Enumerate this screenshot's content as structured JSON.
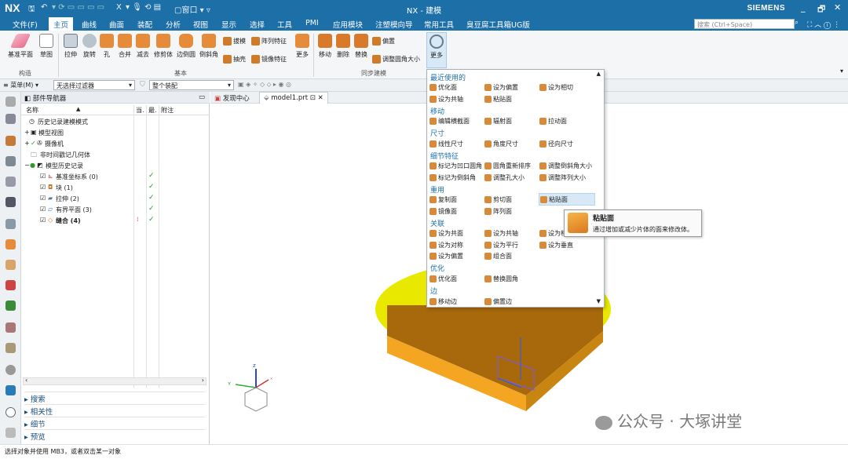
{
  "titlebar": {
    "logo": "NX",
    "title": "NX - 建模",
    "brand": "SIEMENS",
    "window_label": "窗口",
    "quick_close": "X"
  },
  "menu_tabs": [
    "文件(F)",
    "主页",
    "曲线",
    "曲面",
    "装配",
    "分析",
    "视图",
    "显示",
    "选择",
    "工具",
    "PMI",
    "应用模块",
    "注塑模向导",
    "常用工具",
    "臭豆腐工具箱UG版"
  ],
  "search": {
    "placeholder": "搜索 (Ctrl+Space)"
  },
  "ribbon": {
    "buttons": [
      "基准平面",
      "草图",
      "拉伸",
      "旋转",
      "孔",
      "合并",
      "减去",
      "修剪体",
      "边倒圆",
      "倒斜角",
      "更多",
      "移动",
      "删除",
      "替换",
      "更多"
    ],
    "small_buttons": [
      "拔模",
      "阵列特征",
      "抽壳",
      "镜像特征",
      "偏置",
      "调整圆角大小"
    ],
    "groups": [
      "构造",
      "基本",
      "同步建模"
    ]
  },
  "selbar": {
    "menu": "菜单(M)",
    "filter": "无选择过滤器",
    "scope": "整个装配"
  },
  "navigator": {
    "title": "部件导航器",
    "columns": [
      "名称",
      "当.",
      "最.",
      "附注"
    ],
    "rows": [
      {
        "label": "历史记录建模模式",
        "check": ""
      },
      {
        "label": "模型视图",
        "check": ""
      },
      {
        "label": "摄像机",
        "check": ""
      },
      {
        "label": "非时间戳记几何体",
        "check": ""
      },
      {
        "label": "模型历史记录",
        "check": ""
      },
      {
        "label": "基准坐标系 (0)",
        "check": "✓"
      },
      {
        "label": "块 (1)",
        "check": "✓"
      },
      {
        "label": "拉伸 (2)",
        "check": "✓"
      },
      {
        "label": "有界平面 (3)",
        "check": "✓"
      },
      {
        "label": "缝合 (4)",
        "check": "✓"
      }
    ],
    "accordion": [
      "搜索",
      "相关性",
      "细节",
      "预览"
    ]
  },
  "doc_tabs": [
    "发现中心",
    "model1.prt"
  ],
  "more_menu": {
    "sections": [
      {
        "title": "最近使用的",
        "items": [
          "优化面",
          "设为偏置",
          "设为相切",
          "设为共轴",
          "粘贴面"
        ]
      },
      {
        "title": "移动",
        "items": [
          "编辑横截面",
          "辐射面",
          "拉动面"
        ]
      },
      {
        "title": "尺寸",
        "items": [
          "线性尺寸",
          "角度尺寸",
          "径向尺寸"
        ]
      },
      {
        "title": "细节特征",
        "items": [
          "标记为凹口圆角",
          "圆角重新排序",
          "调整倒斜角大小",
          "标记为倒斜角",
          "调整孔大小",
          "调整阵列大小"
        ]
      },
      {
        "title": "重用",
        "items": [
          "复制面",
          "剪切面",
          "粘贴面",
          "镜像面",
          "阵列面"
        ]
      },
      {
        "title": "关联",
        "items": [
          "设为共面",
          "设为共轴",
          "设为相",
          "设为对称",
          "设为平行",
          "设为垂直",
          "设为偏置",
          "组合面"
        ]
      },
      {
        "title": "优化",
        "items": [
          "优化面",
          "替换圆角"
        ]
      },
      {
        "title": "边",
        "items": [
          "移动边",
          "偏置边"
        ]
      }
    ]
  },
  "tooltip": {
    "title": "粘贴面",
    "desc": "通过增加或减少片体的面来修改体。"
  },
  "watermark": "公众号 · 大塚讲堂",
  "status": "选择对象并使用 MB3，或者双击某一对象"
}
